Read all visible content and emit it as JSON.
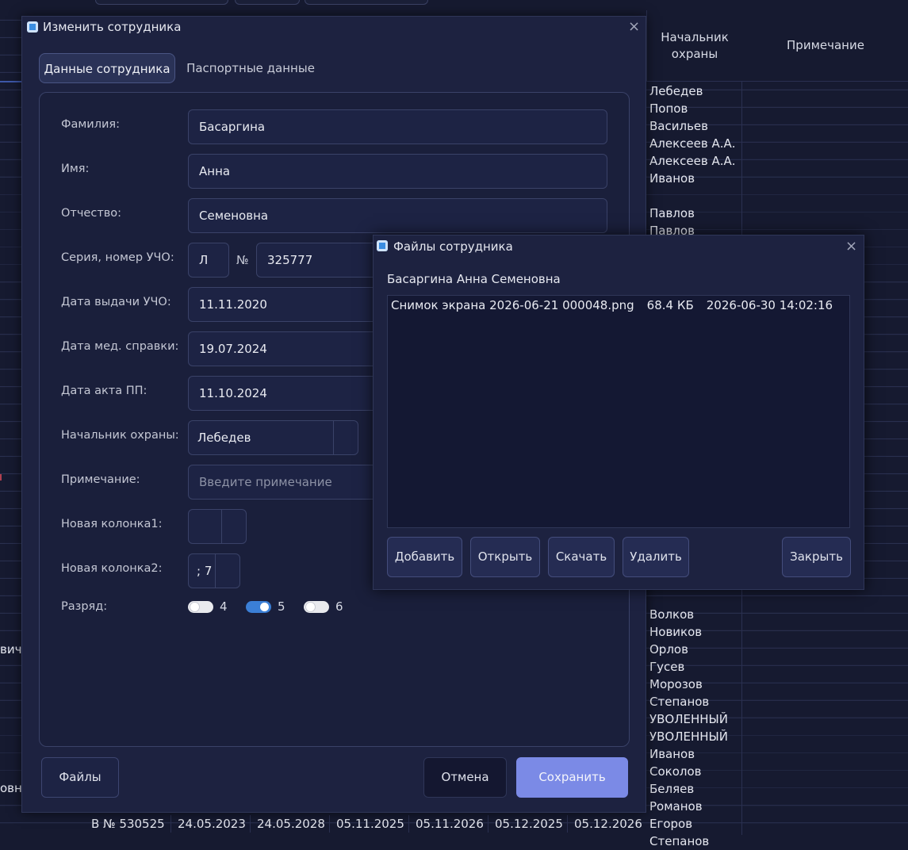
{
  "background_table": {
    "headers": [
      "Начальник охраны",
      "Примечание"
    ],
    "security_heads": [
      "Лебедев",
      "Попов",
      "Васильев",
      "Алексеев А.А.",
      "Алексеев А.А.",
      "Иванов",
      "",
      "Павлов",
      "Павлов",
      "",
      "",
      "",
      "",
      "",
      "",
      "",
      "",
      "",
      "",
      "",
      "",
      "",
      "",
      "",
      "",
      "",
      "",
      "",
      "",
      "",
      "Волков",
      "Новиков",
      "Орлов",
      "Гусев",
      "Морозов",
      "Степанов",
      "УВОЛЕННЫЙ",
      "УВОЛЕННЫЙ",
      "Иванов",
      "Соколов",
      "Беляев",
      "Романов",
      "Егоров",
      "Степанов"
    ],
    "left_fragments": [
      "вич",
      "овна"
    ],
    "bottom_row": [
      "В № 530525",
      "24.05.2023",
      "24.05.2028",
      "05.11.2025",
      "05.11.2026",
      "05.12.2025",
      "05.12.2026"
    ]
  },
  "edit_dialog": {
    "title": "Изменить сотрудника",
    "tabs": [
      {
        "label": "Данные сотрудника",
        "active": true
      },
      {
        "label": "Паспортные данные",
        "active": false
      }
    ],
    "fields": {
      "last_name": {
        "label": "Фамилия:",
        "value": "Басаргина"
      },
      "first_name": {
        "label": "Имя:",
        "value": "Анна"
      },
      "patronymic": {
        "label": "Отчество:",
        "value": "Семеновна"
      },
      "ucho": {
        "label": "Серия, номер УЧО:",
        "series": "Л",
        "number_sign": "№",
        "number": "325777"
      },
      "ucho_date": {
        "label": "Дата выдачи УЧО:",
        "value": "11.11.2020"
      },
      "med_date": {
        "label": "Дата мед. справки:",
        "value": "19.07.2024"
      },
      "pp_date": {
        "label": "Дата акта ПП:",
        "value": "11.10.2024"
      },
      "security_head": {
        "label": "Начальник охраны:",
        "value": "Лебедев"
      },
      "note": {
        "label": "Примечание:",
        "placeholder": "Введите примечание"
      },
      "new_col1": {
        "label": "Новая колонка1:",
        "value": ""
      },
      "new_col2": {
        "label": "Новая колонка2:",
        "value": "; 7"
      },
      "grade": {
        "label": "Разряд:",
        "options": [
          {
            "label": "4",
            "on": false
          },
          {
            "label": "5",
            "on": true
          },
          {
            "label": "6",
            "on": false
          }
        ]
      }
    },
    "buttons": {
      "files": "Файлы",
      "cancel": "Отмена",
      "save": "Сохранить"
    }
  },
  "files_dialog": {
    "title": "Файлы сотрудника",
    "employee_name": "Басаргина Анна Семеновна",
    "files": [
      {
        "name": "Снимок экрана 2026-06-21 000048.png",
        "size": "68.4 КБ",
        "date": "2026-06-30 14:02:16"
      }
    ],
    "buttons": {
      "add": "Добавить",
      "open": "Открыть",
      "download": "Скачать",
      "delete": "Удалить",
      "close": "Закрыть"
    }
  },
  "colors": {
    "accent": "#7b8ae6",
    "toggle_on": "#3b7fd6",
    "background": "#161a30"
  }
}
